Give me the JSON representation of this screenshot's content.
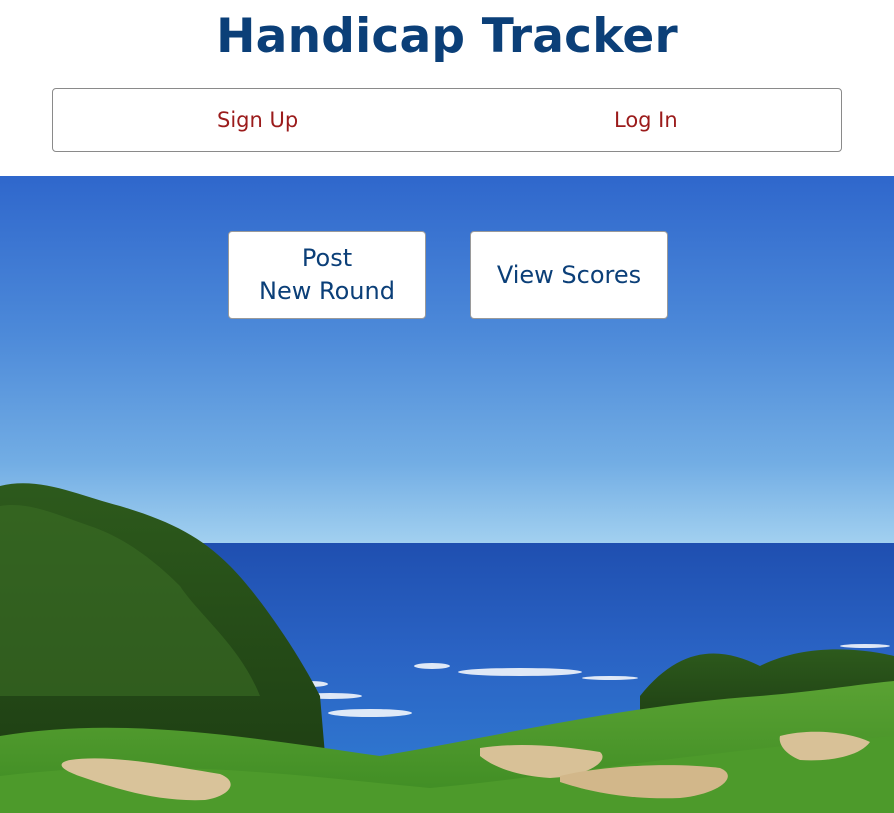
{
  "header": {
    "title": "Handicap Tracker",
    "title_color": "#0b3f78"
  },
  "auth": {
    "signup_label": "Sign Up",
    "login_label": "Log In",
    "link_color": "#9b1b1b"
  },
  "actions": {
    "post_round_line1": "Post",
    "post_round_line2": "New Round",
    "view_scores_label": "View Scores"
  },
  "hero": {
    "image_subject": "golf-course-ocean-view"
  }
}
